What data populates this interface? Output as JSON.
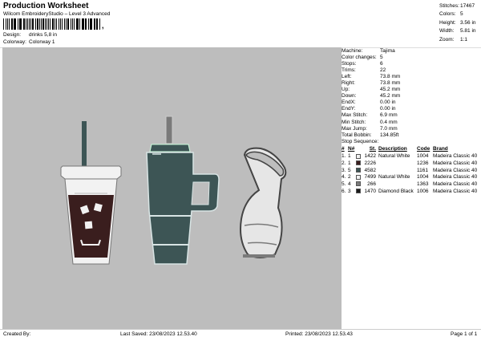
{
  "header": {
    "title": "Production Worksheet",
    "subtitle": "Wilcom EmbroideryStudio – Level 3 Advanced",
    "barcode_mark": ",",
    "design_label": "Design:",
    "design_value": "drinks 5,8 in",
    "colorway_label": "Colorway:",
    "colorway_value": "Colorway 1"
  },
  "stats": [
    {
      "label": "Stitches:",
      "value": "17467"
    },
    {
      "label": "Colors:",
      "value": "5"
    },
    {
      "label": "Height:",
      "value": "3.56 in"
    },
    {
      "label": "Width:",
      "value": "5.81 in"
    },
    {
      "label": "Zoom:",
      "value": "1:1"
    }
  ],
  "machine_info": [
    {
      "label": "Machine:",
      "value": "Tajima"
    },
    {
      "label": "Color changes:",
      "value": "5"
    },
    {
      "label": "Stops:",
      "value": "6"
    },
    {
      "label": "Trims:",
      "value": "22"
    },
    {
      "label": "Left:",
      "value": "73.8 mm"
    },
    {
      "label": "Right:",
      "value": "73.8 mm"
    },
    {
      "label": "Up:",
      "value": "45.2 mm"
    },
    {
      "label": "Down:",
      "value": "45.2 mm"
    },
    {
      "label": "EndX:",
      "value": "0.00 in"
    },
    {
      "label": "EndY:",
      "value": "0.00 in"
    },
    {
      "label": "Max Stitch:",
      "value": "6.9 mm"
    },
    {
      "label": "Min Stitch:",
      "value": "0.4 mm"
    },
    {
      "label": "Max Jump:",
      "value": "7.0 mm"
    },
    {
      "label": "Total Bobbin:",
      "value": "134.85ft"
    }
  ],
  "stop_sequence": {
    "title": "Stop Sequence:",
    "columns": [
      "#",
      "N#",
      "St.",
      "Description",
      "Code",
      "Brand"
    ],
    "rows": [
      {
        "num": "1.",
        "n": "1",
        "color": "#f2f2f2",
        "st": "1422",
        "desc": "Natural White",
        "code": "1004",
        "brand": "Madeira Classic 40"
      },
      {
        "num": "2.",
        "n": "1",
        "color": "#3a1e1e",
        "st": "2226",
        "desc": "",
        "code": "1236",
        "brand": "Madeira Classic 40"
      },
      {
        "num": "3.",
        "n": "5",
        "color": "#3d5555",
        "st": "4582",
        "desc": "",
        "code": "1161",
        "brand": "Madeira Classic 40"
      },
      {
        "num": "4.",
        "n": "2",
        "color": "#f2f2f2",
        "st": "7499",
        "desc": "Natural White",
        "code": "1004",
        "brand": "Madeira Classic 40"
      },
      {
        "num": "5.",
        "n": "4",
        "color": "#7a7a7a",
        "st": "266",
        "desc": "",
        "code": "1363",
        "brand": "Madeira Classic 40"
      },
      {
        "num": "6.",
        "n": "3",
        "color": "#1a1a1a",
        "st": "1470",
        "desc": "Diamond Black",
        "code": "1006",
        "brand": "Madeira Classic 40"
      }
    ]
  },
  "footer": {
    "created_by": "Created By:",
    "last_saved": "Last Saved: 23/08/2023 12.53.40",
    "printed": "Printed: 23/08/2023 12.53.43",
    "page": "Page 1 of 1"
  },
  "colors": {
    "canvas_bg": "#bdbdbd",
    "thread_white": "#f2f2f2",
    "thread_teal": "#3d5555",
    "thread_brown": "#3a1e1e",
    "thread_gray": "#7a7a7a"
  }
}
